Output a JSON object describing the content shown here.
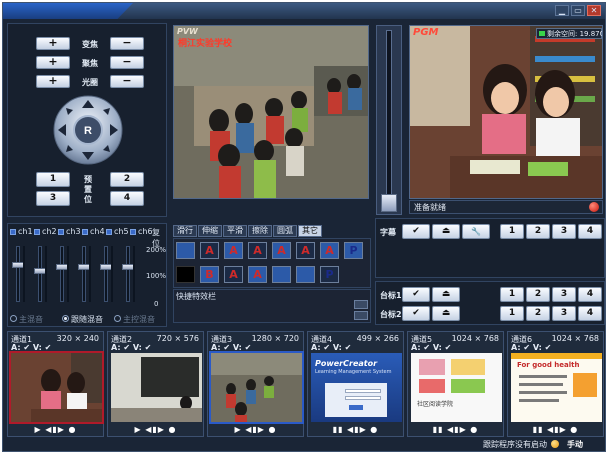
{
  "window": {
    "min_glyph": "▁",
    "restore_glyph": "▭",
    "close_glyph": "✕"
  },
  "ptz": {
    "rows": [
      {
        "label": "变焦",
        "plus": "+",
        "minus": "−"
      },
      {
        "label": "聚焦",
        "plus": "+",
        "minus": "−"
      },
      {
        "label": "光圈",
        "plus": "+",
        "minus": "−"
      }
    ],
    "center_label": "R",
    "preset_label": "预置位",
    "presets": [
      "1",
      "2",
      "3",
      "4"
    ]
  },
  "pvw": {
    "tag": "PVW",
    "overlay": "桐江实验学校"
  },
  "pgm": {
    "tag": "PGM",
    "space": "剩余空间: 19.87G",
    "status": "准备就绪"
  },
  "audio": {
    "channels": [
      "ch1",
      "ch2",
      "ch3",
      "ch4",
      "ch5",
      "ch6"
    ],
    "reset": "复位",
    "scale": [
      "200%",
      "100%",
      "0"
    ],
    "levels": [
      0.66,
      0.56,
      0.62,
      0.62,
      0.62,
      0.62
    ],
    "modes": [
      "主混音",
      "跟随混音",
      "主控混音"
    ],
    "selected_mode": "跟随混音"
  },
  "effects": {
    "tabs": [
      "滑行",
      "伸缩",
      "平滑",
      "擦除",
      "圆弧",
      "其它"
    ],
    "active_tab": "其它",
    "caption": "快捷特效栏",
    "row1": [
      "",
      "A",
      "A",
      "A",
      "A",
      "A",
      "A",
      "P"
    ],
    "row2": [
      "",
      "B",
      "A",
      "A",
      "",
      "",
      "P"
    ]
  },
  "subtitle": {
    "label": "字幕",
    "check": "✔",
    "eject": "⏏",
    "tool": "🔧",
    "numbers": [
      "1",
      "2",
      "3",
      "4"
    ]
  },
  "logos": [
    {
      "label": "台标1",
      "check": "✔",
      "eject": "⏏",
      "numbers": [
        "1",
        "2",
        "3",
        "4"
      ]
    },
    {
      "label": "台标2",
      "check": "✔",
      "eject": "⏏",
      "numbers": [
        "1",
        "2",
        "3",
        "4"
      ]
    }
  ],
  "channels": [
    {
      "name": "通道1",
      "res": "320 × 240",
      "av": "A: ✔  V: ✔",
      "ctrl": "▶ ◀▮▶ ●"
    },
    {
      "name": "通道2",
      "res": "720 × 576",
      "av": "A: ✔  V: ✔",
      "ctrl": "▶ ◀▮▶ ●"
    },
    {
      "name": "通道3",
      "res": "1280 × 720",
      "av": "A: ✔  V: ✔",
      "ctrl": "▶ ◀▮▶ ●"
    },
    {
      "name": "通道4",
      "res": "499 × 266",
      "av": "A: ✔  V: ✔",
      "ctrl": "▮▮ ◀▮▶ ●",
      "screen_title": "PowerCreator",
      "screen_sub": "Learning Management System"
    },
    {
      "name": "通道5",
      "res": "1024 × 768",
      "av": "A: ✔  V: ✔",
      "ctrl": "▮▮ ◀▮▶ ●",
      "screen_caption": "社区阅读学院"
    },
    {
      "name": "通道6",
      "res": "1024 × 768",
      "av": "A: ✔  V: ✔",
      "ctrl": "▮▮ ◀▮▶ ●",
      "screen_title": "For good health"
    }
  ],
  "statusbar": {
    "tracking": "跟踪程序没有启动",
    "mode": "手动"
  }
}
